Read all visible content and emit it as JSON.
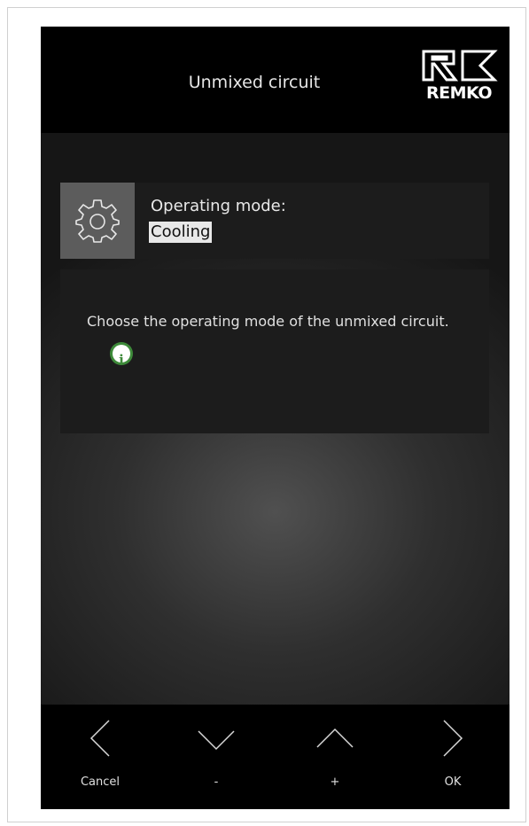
{
  "header": {
    "title": "Unmixed circuit",
    "logo_text": "REMKO"
  },
  "setting": {
    "icon": "gear-icon",
    "label": "Operating mode:",
    "value": "Cooling"
  },
  "description": {
    "text": "Choose the operating mode of the unmixed circuit.",
    "info_icon": "info-icon"
  },
  "footer": {
    "buttons": [
      {
        "icon": "chevron-left-icon",
        "label": "Cancel"
      },
      {
        "icon": "chevron-down-icon",
        "label": "-"
      },
      {
        "icon": "chevron-up-icon",
        "label": "+"
      },
      {
        "icon": "chevron-right-icon",
        "label": "OK"
      }
    ]
  },
  "colors": {
    "header_bg": "#000000",
    "panel_bg": "#1c1c1c",
    "icon_box_bg": "#5c5c5c",
    "info_green": "#3e8a3a"
  }
}
